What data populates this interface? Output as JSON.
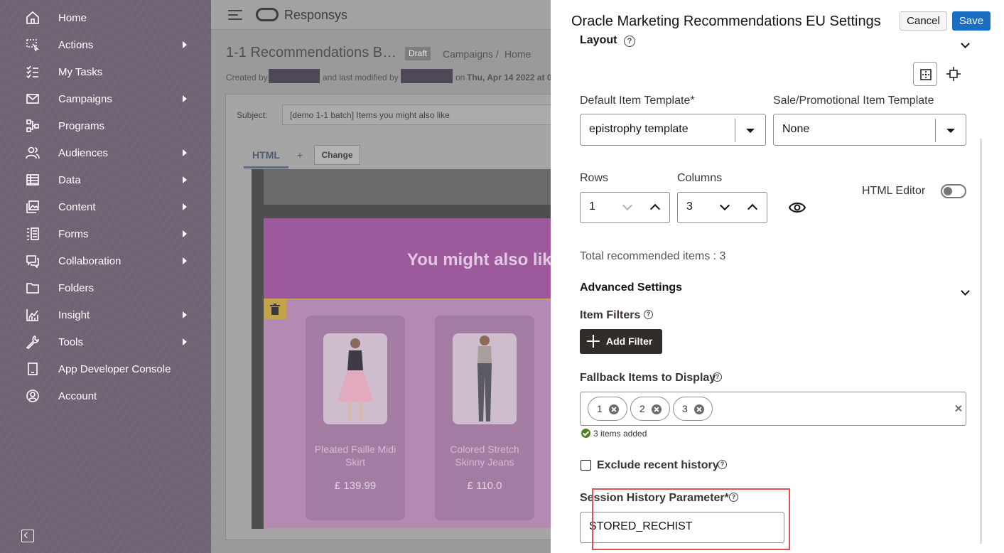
{
  "sidebar": {
    "items": [
      {
        "label": "Home",
        "icon": "home-icon",
        "submenu": false
      },
      {
        "label": "Actions",
        "icon": "cursor-select-icon",
        "submenu": true
      },
      {
        "label": "My Tasks",
        "icon": "task-list-icon",
        "submenu": false
      },
      {
        "label": "Campaigns",
        "icon": "envelope-icon",
        "submenu": true
      },
      {
        "label": "Programs",
        "icon": "flow-icon",
        "submenu": false
      },
      {
        "label": "Audiences",
        "icon": "people-icon",
        "submenu": true
      },
      {
        "label": "Data",
        "icon": "table-icon",
        "submenu": true
      },
      {
        "label": "Content",
        "icon": "images-icon",
        "submenu": true
      },
      {
        "label": "Forms",
        "icon": "form-icon",
        "submenu": true
      },
      {
        "label": "Collaboration",
        "icon": "chat-icon",
        "submenu": true
      },
      {
        "label": "Folders",
        "icon": "folder-icon",
        "submenu": false
      },
      {
        "label": "Insight",
        "icon": "chart-icon",
        "submenu": true
      },
      {
        "label": "Tools",
        "icon": "wrench-icon",
        "submenu": true
      },
      {
        "label": "App Developer Console",
        "icon": "device-icon",
        "submenu": false
      },
      {
        "label": "Account",
        "icon": "account-icon",
        "submenu": false
      }
    ]
  },
  "topbar": {
    "brand": "Responsys"
  },
  "document": {
    "title": "1-1 Recommendations B…",
    "status": "Draft",
    "breadcrumb": [
      "Campaigns",
      "Home"
    ],
    "meta_created": "Created by",
    "meta_modified": "and last modified by",
    "meta_date": "on",
    "meta_date_value": "Thu, Apr 14 2022 at 0",
    "subject_label": "Subject:",
    "subject_value": "[demo 1-1 batch] Items you might also like",
    "tab_html": "HTML",
    "tab_add": "+",
    "change_button": "Change"
  },
  "email": {
    "heading": "You might also lik",
    "products": [
      {
        "name": "Pleated Faille Midi Skirt",
        "price": "£ 139.99"
      },
      {
        "name": "Colored Stretch Skinny Jeans",
        "price": "£ 110.0"
      }
    ]
  },
  "drawer": {
    "title": "Oracle Marketing Recommendations EU Settings",
    "cancel_label": "Cancel",
    "save_label": "Save",
    "layout": {
      "title": "Layout",
      "default_template_label": "Default Item Template*",
      "default_template_value": "epistrophy template",
      "sale_template_label": "Sale/Promotional Item Template",
      "sale_template_value": "None",
      "rows_label": "Rows",
      "rows_value": "1",
      "columns_label": "Columns",
      "columns_value": "3",
      "html_editor_label": "HTML Editor",
      "html_editor_on": false,
      "total_text": "Total recommended items : 3"
    },
    "advanced": {
      "title": "Advanced Settings",
      "item_filters_label": "Item Filters",
      "add_filter_label": "Add Filter",
      "fallback_label": "Fallback Items to Display",
      "fallback_items": [
        "1",
        "2",
        "3"
      ],
      "fallback_status": "3 items added",
      "exclude_label": "Exclude recent history",
      "exclude_checked": false,
      "session_label": "Session History Parameter*",
      "session_value": "STORED_RECHIST"
    }
  },
  "colors": {
    "sidebar_bg": "#706474",
    "save_button": "#1a6fc5",
    "add_filter_button": "#312d2a",
    "highlight_border": "#e05252",
    "email_header": "#9c5a9c"
  }
}
